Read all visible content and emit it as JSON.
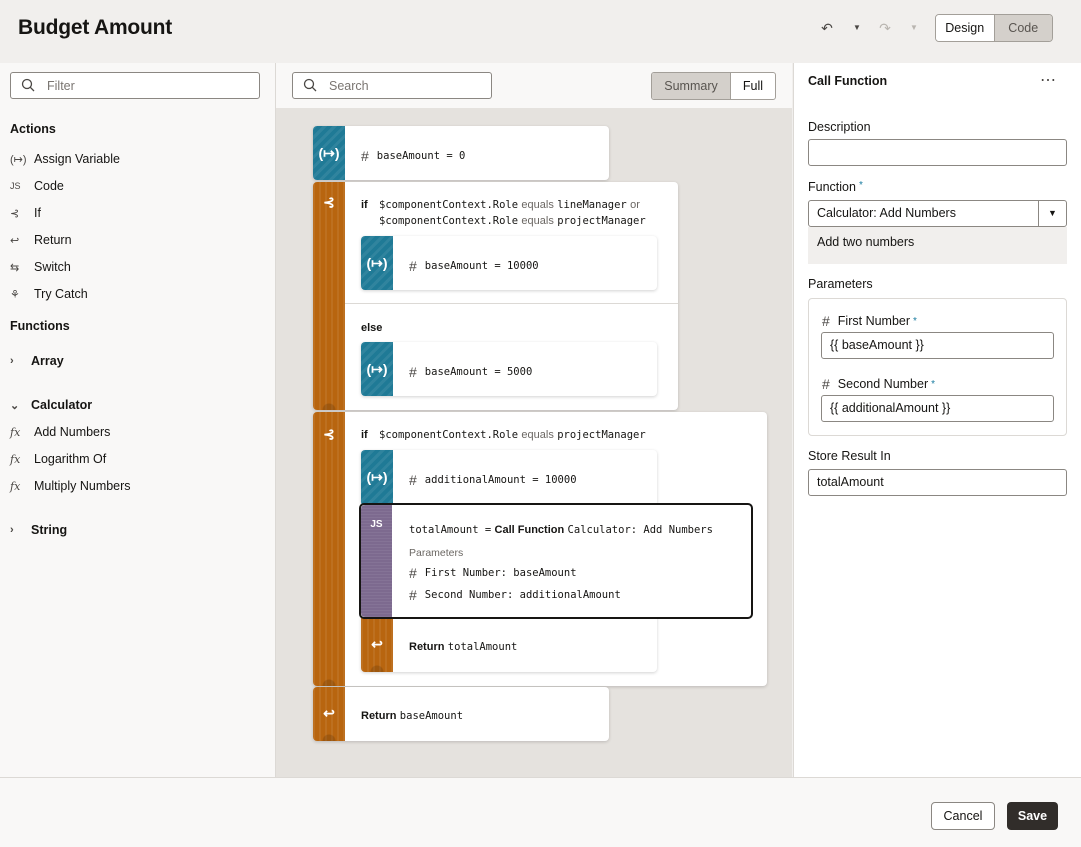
{
  "header": {
    "title": "Budget Amount",
    "undo_icon": "undo-icon",
    "redo_icon": "redo-icon",
    "design_label": "Design",
    "code_label": "Code"
  },
  "palette": {
    "filter_placeholder": "Filter",
    "actions_heading": "Actions",
    "actions": [
      {
        "label": "Assign Variable",
        "icon": "assign-variable-icon",
        "glyph": "(↦)"
      },
      {
        "label": "Code",
        "icon": "code-icon",
        "glyph": "JS"
      },
      {
        "label": "If",
        "icon": "if-icon",
        "glyph": "⊰"
      },
      {
        "label": "Return",
        "icon": "return-icon",
        "glyph": "↩"
      },
      {
        "label": "Switch",
        "icon": "switch-icon",
        "glyph": "⇆"
      },
      {
        "label": "Try Catch",
        "icon": "try-catch-icon",
        "glyph": "⚘"
      }
    ],
    "functions_heading": "Functions",
    "groups": {
      "array": "Array",
      "calculator": "Calculator",
      "string": "String"
    },
    "calculator_functions": [
      "Add Numbers",
      "Logarithm Of",
      "Multiply Numbers"
    ],
    "fx_glyph": "fx"
  },
  "canvas": {
    "search_placeholder": "Search",
    "summary_label": "Summary",
    "full_label": "Full",
    "assign_base": "baseAmount = 0",
    "if1": {
      "kw": "if",
      "line1_a": "$componentContext.Role",
      "line1_op": "equals",
      "line1_b": "lineManager",
      "line1_or": "or",
      "line2_a": "$componentContext.Role",
      "line2_op": "equals",
      "line2_b": "projectManager"
    },
    "assign_10000": "baseAmount = 10000",
    "else_kw": "else",
    "assign_5000": "baseAmount = 5000",
    "if2": {
      "kw": "if",
      "a": "$componentContext.Role",
      "op": "equals",
      "b": "projectManager"
    },
    "assign_additional": "additionalAmount = 10000",
    "call": {
      "lhs": "totalAmount =",
      "kw": "Call Function",
      "fn": "Calculator: Add Numbers",
      "params_label": "Parameters",
      "p1": "First Number: baseAmount",
      "p2": "Second Number: additionalAmount"
    },
    "return_total": {
      "kw": "Return",
      "val": "totalAmount"
    },
    "return_base": {
      "kw": "Return",
      "val": "baseAmount"
    }
  },
  "properties": {
    "title": "Call Function",
    "more_icon": "more-options-icon",
    "description_label": "Description",
    "description_value": "",
    "function_label": "Function",
    "function_value": "Calculator: Add Numbers",
    "function_help": "Add two numbers",
    "parameters_label": "Parameters",
    "param1_label": "First Number",
    "param1_value": "{{ baseAmount }}",
    "param2_label": "Second Number",
    "param2_value": "{{ additionalAmount }}",
    "store_label": "Store Result In",
    "store_value": "totalAmount"
  },
  "footer": {
    "cancel_label": "Cancel",
    "save_label": "Save"
  },
  "colors": {
    "assign": "#1f7a96",
    "control": "#b8650f",
    "code": "#7d6a8f",
    "primary_button": "#312d2a",
    "required": "#1a7ca0"
  }
}
